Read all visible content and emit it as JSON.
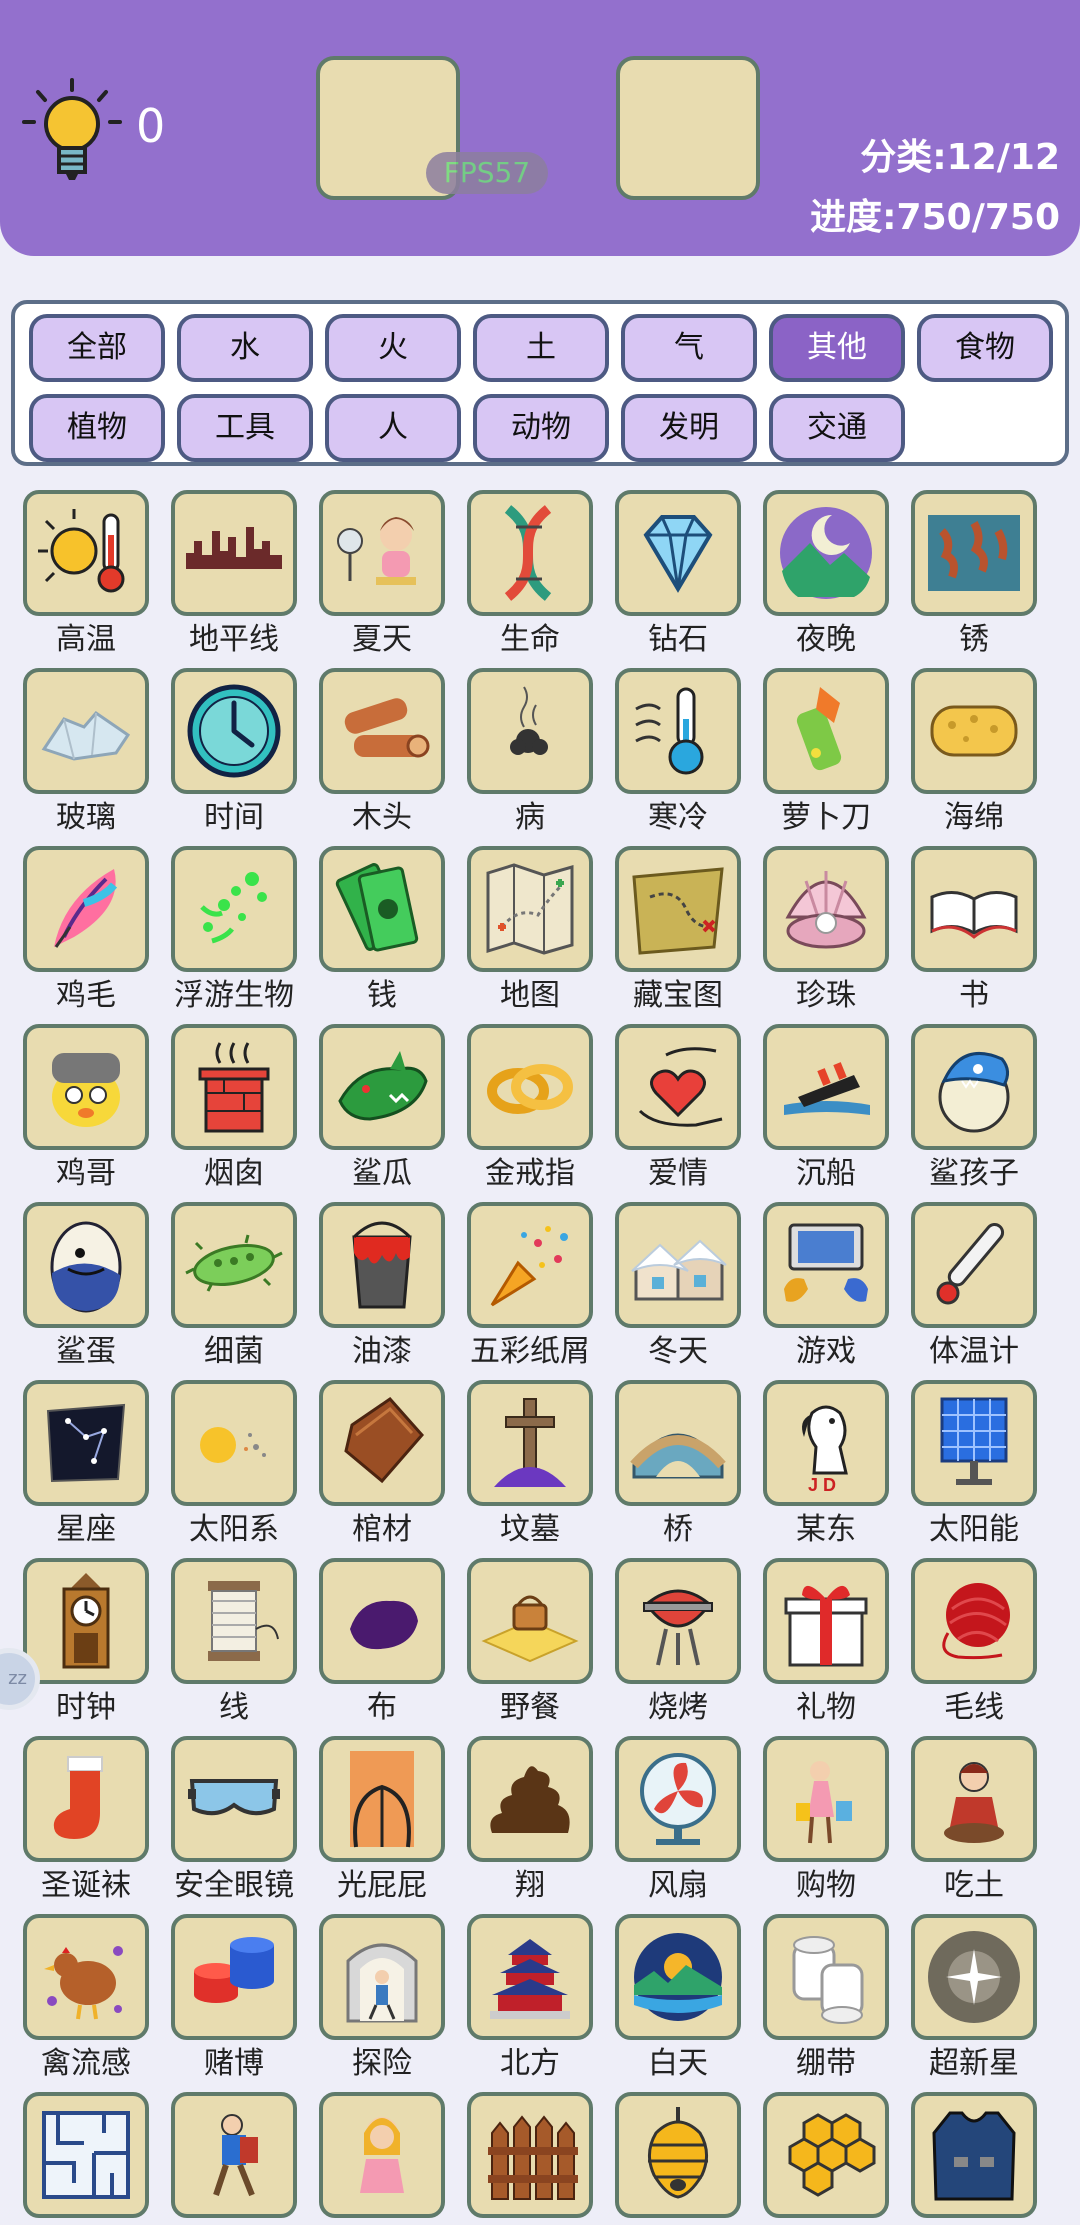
{
  "header": {
    "hint_count": "0",
    "fps": "FPS57",
    "category_stat": "分类:12/12",
    "progress_stat": "进度:750/750"
  },
  "tabs": [
    "全部",
    "水",
    "火",
    "土",
    "气",
    "其他",
    "食物",
    "植物",
    "工具",
    "人",
    "动物",
    "发明",
    "交通"
  ],
  "active_tab": "其他",
  "side_button": "zz",
  "items": [
    {
      "label": "高温",
      "icon": "high-temperature-icon"
    },
    {
      "label": "地平线",
      "icon": "horizon-icon"
    },
    {
      "label": "夏天",
      "icon": "summer-icon"
    },
    {
      "label": "生命",
      "icon": "life-dna-icon"
    },
    {
      "label": "钻石",
      "icon": "diamond-icon"
    },
    {
      "label": "夜晚",
      "icon": "night-icon"
    },
    {
      "label": "锈",
      "icon": "rust-icon"
    },
    {
      "label": "玻璃",
      "icon": "glass-icon"
    },
    {
      "label": "时间",
      "icon": "clock-time-icon"
    },
    {
      "label": "木头",
      "icon": "wood-icon"
    },
    {
      "label": "病",
      "icon": "sickness-icon"
    },
    {
      "label": "寒冷",
      "icon": "cold-thermometer-icon"
    },
    {
      "label": "萝卜刀",
      "icon": "radish-knife-icon"
    },
    {
      "label": "海绵",
      "icon": "sponge-icon"
    },
    {
      "label": "鸡毛",
      "icon": "feather-icon"
    },
    {
      "label": "浮游生物",
      "icon": "plankton-icon"
    },
    {
      "label": "钱",
      "icon": "money-icon"
    },
    {
      "label": "地图",
      "icon": "map-icon"
    },
    {
      "label": "藏宝图",
      "icon": "treasure-map-icon"
    },
    {
      "label": "珍珠",
      "icon": "pearl-icon"
    },
    {
      "label": "书",
      "icon": "book-icon"
    },
    {
      "label": "鸡哥",
      "icon": "chicken-brother-icon"
    },
    {
      "label": "烟囱",
      "icon": "chimney-icon"
    },
    {
      "label": "鲨瓜",
      "icon": "shark-melon-icon"
    },
    {
      "label": "金戒指",
      "icon": "gold-ring-icon"
    },
    {
      "label": "爱情",
      "icon": "love-icon"
    },
    {
      "label": "沉船",
      "icon": "shipwreck-icon"
    },
    {
      "label": "鲨孩子",
      "icon": "shark-kid-icon"
    },
    {
      "label": "鲨蛋",
      "icon": "shark-egg-icon"
    },
    {
      "label": "细菌",
      "icon": "bacteria-icon"
    },
    {
      "label": "油漆",
      "icon": "paint-bucket-icon"
    },
    {
      "label": "五彩纸屑",
      "icon": "confetti-icon"
    },
    {
      "label": "冬天",
      "icon": "winter-icon"
    },
    {
      "label": "游戏",
      "icon": "game-icon"
    },
    {
      "label": "体温计",
      "icon": "thermometer-icon"
    },
    {
      "label": "星座",
      "icon": "constellation-icon"
    },
    {
      "label": "太阳系",
      "icon": "solar-system-icon"
    },
    {
      "label": "棺材",
      "icon": "coffin-icon"
    },
    {
      "label": "坟墓",
      "icon": "grave-icon"
    },
    {
      "label": "桥",
      "icon": "bridge-icon"
    },
    {
      "label": "某东",
      "icon": "jd-dog-icon"
    },
    {
      "label": "太阳能",
      "icon": "solar-panel-icon"
    },
    {
      "label": "时钟",
      "icon": "clock-tower-icon"
    },
    {
      "label": "线",
      "icon": "thread-spool-icon"
    },
    {
      "label": "布",
      "icon": "cloth-icon"
    },
    {
      "label": "野餐",
      "icon": "picnic-icon"
    },
    {
      "label": "烧烤",
      "icon": "grill-icon"
    },
    {
      "label": "礼物",
      "icon": "gift-icon"
    },
    {
      "label": "毛线",
      "icon": "yarn-icon"
    },
    {
      "label": "圣诞袜",
      "icon": "christmas-stocking-icon"
    },
    {
      "label": "安全眼镜",
      "icon": "safety-goggles-icon"
    },
    {
      "label": "光屁屁",
      "icon": "bare-butt-icon"
    },
    {
      "label": "翔",
      "icon": "poop-icon"
    },
    {
      "label": "风扇",
      "icon": "fan-icon"
    },
    {
      "label": "购物",
      "icon": "shopping-icon"
    },
    {
      "label": "吃土",
      "icon": "eat-dirt-icon"
    },
    {
      "label": "禽流感",
      "icon": "bird-flu-icon"
    },
    {
      "label": "赌博",
      "icon": "gambling-chips-icon"
    },
    {
      "label": "探险",
      "icon": "adventure-icon"
    },
    {
      "label": "北方",
      "icon": "north-temple-icon"
    },
    {
      "label": "白天",
      "icon": "daytime-icon"
    },
    {
      "label": "绷带",
      "icon": "bandage-icon"
    },
    {
      "label": "超新星",
      "icon": "supernova-icon"
    },
    {
      "label": "",
      "icon": "maze-icon"
    },
    {
      "label": "",
      "icon": "hiker-icon"
    },
    {
      "label": "",
      "icon": "girl-icon"
    },
    {
      "label": "",
      "icon": "fence-icon"
    },
    {
      "label": "",
      "icon": "beehive-icon"
    },
    {
      "label": "",
      "icon": "honeycomb-icon"
    },
    {
      "label": "",
      "icon": "vest-icon"
    }
  ],
  "colors": {
    "header": "#9370cd",
    "tab": "#d8c6f4",
    "tab_active": "#8b63c6",
    "tile": "#e8dcb0",
    "tile_border": "#5f7a6a",
    "fps_text": "#6fdd7a"
  }
}
